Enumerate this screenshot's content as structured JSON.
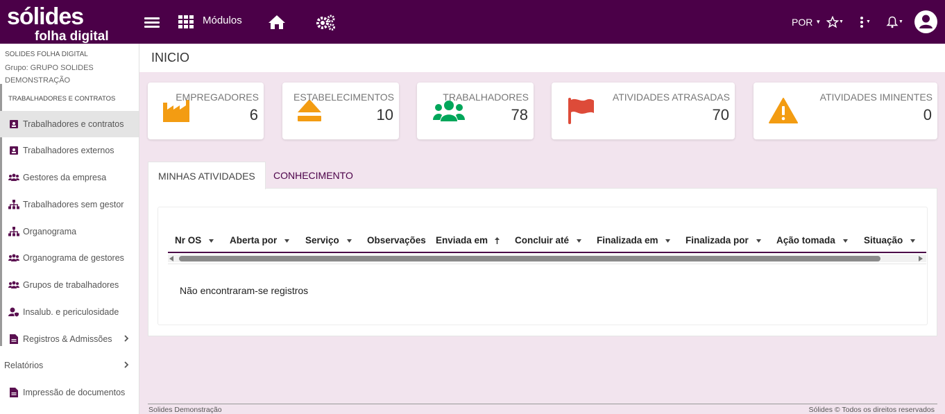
{
  "header": {
    "logo_line1": "sólides",
    "logo_line2": "folha digital",
    "modules_label": "Módulos",
    "language_label": "POR",
    "icons": [
      "menu-icon",
      "apps-grid-icon",
      "home-icon",
      "settings-gears-icon",
      "star-icon",
      "more-vertical-icon",
      "bell-icon",
      "user-avatar-icon"
    ],
    "brand_color": "#4b0048"
  },
  "sidebar": {
    "org_name": "SOLIDES FOLHA DIGITAL",
    "group_label": "Grupo: GRUPO SOLIDES DEMONSTRAÇÃO",
    "section_title": "TRABALHADORES E CONTRATOS",
    "items": [
      {
        "label": "Trabalhadores e contratos",
        "icon": "id-badge-icon"
      },
      {
        "label": "Trabalhadores externos",
        "icon": "id-badge-icon"
      },
      {
        "label": "Gestores da empresa",
        "icon": "users-icon"
      },
      {
        "label": "Trabalhadores sem gestor",
        "icon": "sitemap-icon"
      },
      {
        "label": "Organograma",
        "icon": "sitemap-icon"
      },
      {
        "label": "Organograma de gestores",
        "icon": "users-icon"
      },
      {
        "label": "Grupos de trabalhadores",
        "icon": "users-icon"
      },
      {
        "label": "Insalub. e periculosidade",
        "icon": "user-shield-icon"
      },
      {
        "label": "Registros & Admissões",
        "icon": "document-icon"
      }
    ],
    "reports_label": "Relatórios",
    "print_label": "Impressão de documentos"
  },
  "main": {
    "page_title": "INICIO",
    "cards": [
      {
        "label": "EMPREGADORES",
        "value": "6",
        "icon": "factory-icon",
        "color": "#f39c12"
      },
      {
        "label": "ESTABELECIMENTOS",
        "value": "10",
        "icon": "eject-icon",
        "color": "#f39c12"
      },
      {
        "label": "TRABALHADORES",
        "value": "78",
        "icon": "users-icon",
        "color": "#00a65a"
      },
      {
        "label": "ATIVIDADES ATRASADAS",
        "value": "70",
        "icon": "flag-icon",
        "color": "#dd4b39"
      },
      {
        "label": "ATIVIDADES IMINENTES",
        "value": "0",
        "icon": "warning-icon",
        "color": "#f39c12"
      }
    ],
    "tabs": [
      {
        "label": "MINHAS ATIVIDADES",
        "active": true
      },
      {
        "label": "CONHECIMENTO",
        "active": false
      }
    ],
    "table": {
      "columns": [
        "Nr OS",
        "Aberta por",
        "Serviço",
        "Observações",
        "Enviada em",
        "Concluir até",
        "Finalizada em",
        "Finalizada por",
        "Ação tomada",
        "Situação"
      ],
      "empty_message": "Não encontraram-se registros"
    }
  },
  "footer": {
    "left": "Solides Demonstração",
    "right": "Sólides © Todos os direitos reservados"
  }
}
